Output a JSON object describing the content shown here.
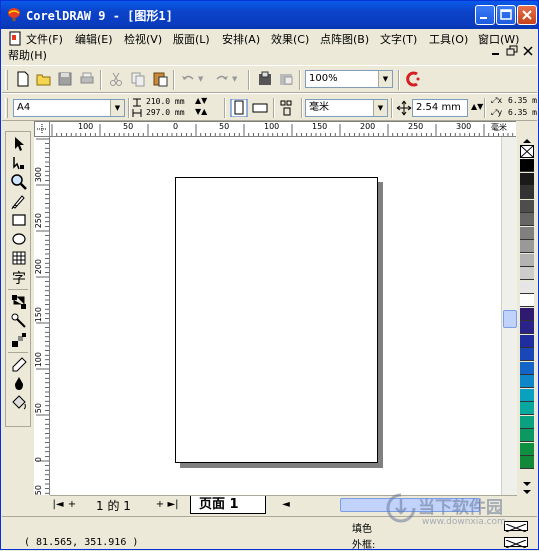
{
  "window": {
    "title": "CorelDRAW 9 - [图形1]"
  },
  "menu": {
    "items": [
      {
        "label": "文件(F)"
      },
      {
        "label": "编辑(E)"
      },
      {
        "label": "检视(V)"
      },
      {
        "label": "版面(L)"
      },
      {
        "label": "安排(A)"
      },
      {
        "label": "效果(C)"
      },
      {
        "label": "点阵图(B)"
      },
      {
        "label": "文字(T)"
      },
      {
        "label": "工具(O)"
      },
      {
        "label": "窗口(W)"
      },
      {
        "label": "帮助(H)"
      }
    ]
  },
  "toolbar": {
    "zoom_value": "100%"
  },
  "property_bar": {
    "paper_size": "A4",
    "width": "210.0 mm",
    "height": "297.0 mm",
    "units": "毫米",
    "nudge": "2.54 mm",
    "dup_x": "6.35 m",
    "dup_y": "6.35 m"
  },
  "ruler": {
    "unit_label": "毫米",
    "h_labels": [
      "100",
      "50",
      "0",
      "50",
      "100",
      "150",
      "200",
      "250",
      "300"
    ],
    "v_labels": [
      "300",
      "250",
      "200",
      "150",
      "100",
      "50",
      "0",
      "50"
    ]
  },
  "page_nav": {
    "page_counter": "1 的 1",
    "page_tab": "页面 1"
  },
  "status": {
    "coordinates": "( 81.565, 351.916 )",
    "fill_label": "填色",
    "outline_label": "外框:"
  },
  "watermark": {
    "text": "当下软件园",
    "url": "www.downxia.com"
  },
  "colors": {
    "titlebar": "#0a4fd8",
    "chrome": "#ece9d8",
    "palette": [
      "#000000",
      "#1a1a1a",
      "#333333",
      "#4d4d4d",
      "#666666",
      "#808080",
      "#999999",
      "#b3b3b3",
      "#cccccc",
      "#e6e6e6",
      "#ffffff",
      "#2e1a6e",
      "#2b2488",
      "#1f2d9e",
      "#1a47b8",
      "#1564c8",
      "#0f86c8",
      "#0aa0c0",
      "#08a8a0",
      "#0aa080",
      "#0c9860",
      "#0f9040",
      "#12883a"
    ]
  }
}
